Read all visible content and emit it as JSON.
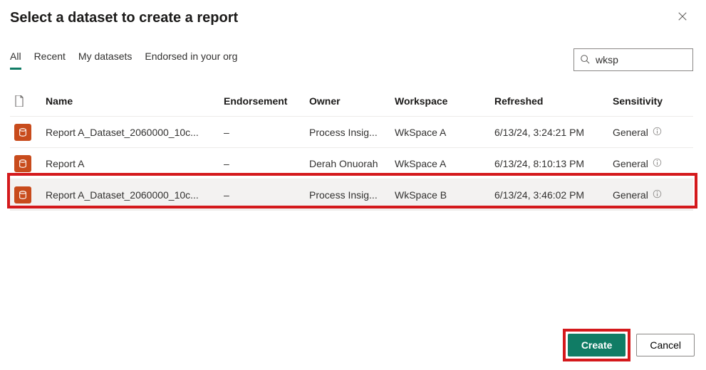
{
  "dialog": {
    "title": "Select a dataset to create a report"
  },
  "tabs": {
    "all": "All",
    "recent": "Recent",
    "my": "My datasets",
    "endorsed": "Endorsed in your org"
  },
  "search": {
    "value": "wksp"
  },
  "columns": {
    "name": "Name",
    "endorsement": "Endorsement",
    "owner": "Owner",
    "workspace": "Workspace",
    "refreshed": "Refreshed",
    "sensitivity": "Sensitivity"
  },
  "rows": [
    {
      "name": "Report A_Dataset_2060000_10c...",
      "endorsement": "–",
      "owner": "Process Insig...",
      "workspace": "WkSpace A",
      "refreshed": "6/13/24, 3:24:21 PM",
      "sensitivity": "General"
    },
    {
      "name": "Report A",
      "endorsement": "–",
      "owner": "Derah Onuorah",
      "workspace": "WkSpace A",
      "refreshed": "6/13/24, 8:10:13 PM",
      "sensitivity": "General"
    },
    {
      "name": "Report A_Dataset_2060000_10c...",
      "endorsement": "–",
      "owner": "Process Insig...",
      "workspace": "WkSpace B",
      "refreshed": "6/13/24, 3:46:02 PM",
      "sensitivity": "General"
    }
  ],
  "footer": {
    "create": "Create",
    "cancel": "Cancel"
  }
}
